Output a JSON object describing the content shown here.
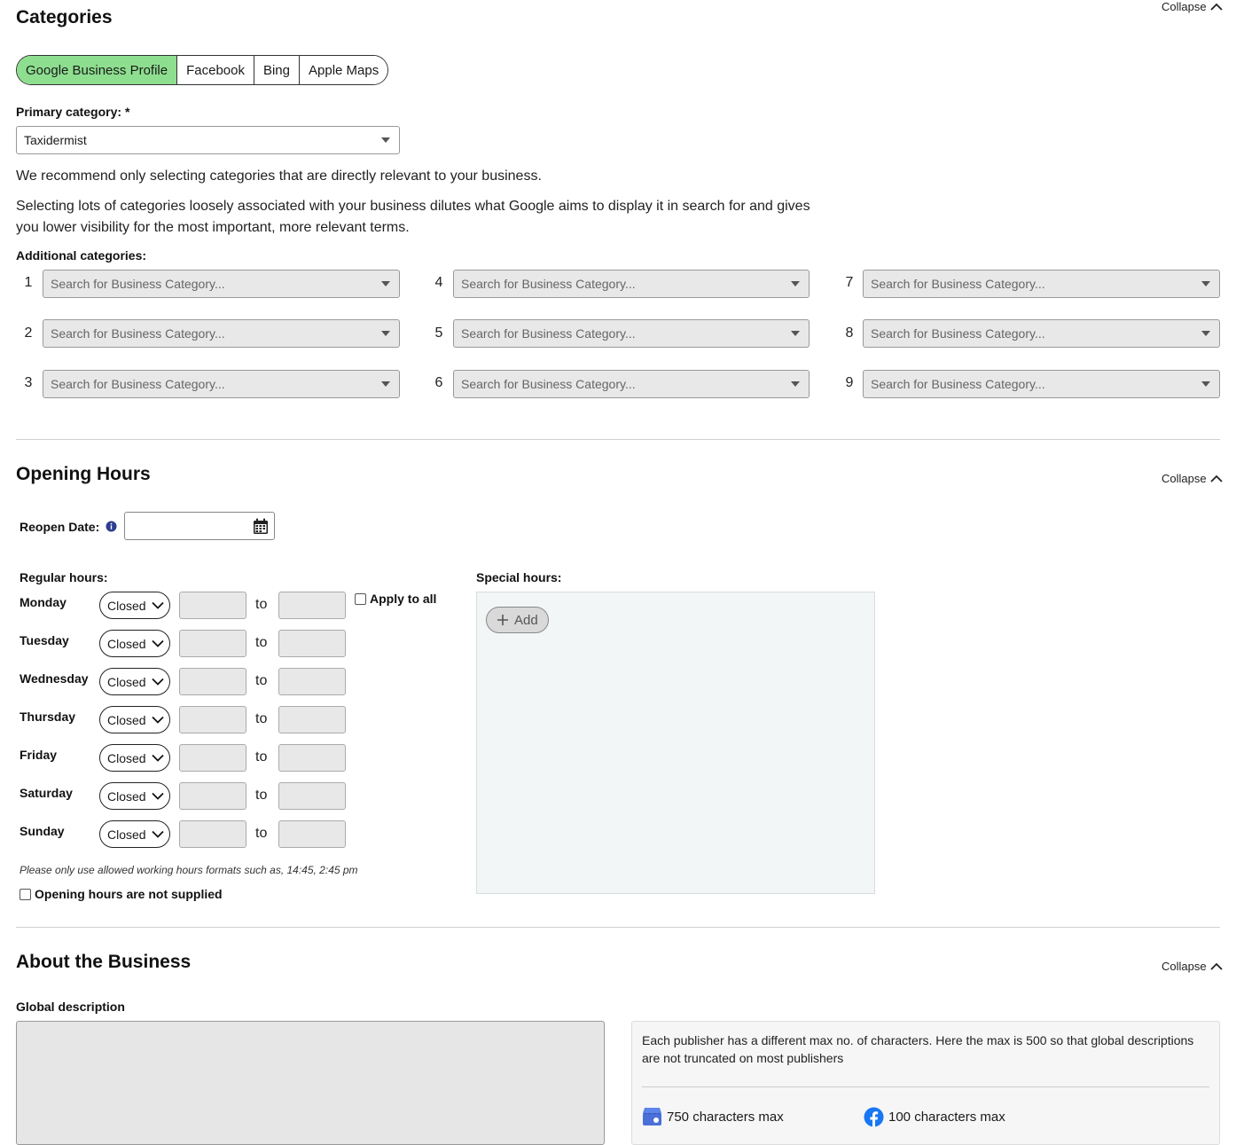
{
  "categories": {
    "title": "Categories",
    "collapse_label": "Collapse",
    "tabs": [
      {
        "label": "Google Business Profile",
        "active": true
      },
      {
        "label": "Facebook",
        "active": false
      },
      {
        "label": "Bing",
        "active": false
      },
      {
        "label": "Apple Maps",
        "active": false
      }
    ],
    "primary_label": "Primary category: *",
    "primary_value": "Taxidermist",
    "recommend_text": "We recommend only selecting categories that are directly relevant to your business.",
    "dilute_text_line1": "Selecting lots of categories loosely associated with your business dilutes what Google aims to display it in search for and gives",
    "dilute_text_line2": "you lower visibility for the most important, more relevant terms.",
    "additional_label": "Additional categories:",
    "additional": [
      {
        "num": "1",
        "placeholder": "Search for Business Category..."
      },
      {
        "num": "2",
        "placeholder": "Search for Business Category..."
      },
      {
        "num": "3",
        "placeholder": "Search for Business Category..."
      },
      {
        "num": "4",
        "placeholder": "Search for Business Category..."
      },
      {
        "num": "5",
        "placeholder": "Search for Business Category..."
      },
      {
        "num": "6",
        "placeholder": "Search for Business Category..."
      },
      {
        "num": "7",
        "placeholder": "Search for Business Category..."
      },
      {
        "num": "8",
        "placeholder": "Search for Business Category..."
      },
      {
        "num": "9",
        "placeholder": "Search for Business Category..."
      }
    ]
  },
  "hours": {
    "title": "Opening Hours",
    "collapse_label": "Collapse",
    "reopen_label": "Reopen Date:",
    "reopen_value": "",
    "regular_label": "Regular hours:",
    "special_label": "Special hours:",
    "apply_all_label": "Apply to all",
    "to_label": "to",
    "days": [
      {
        "day": "Monday",
        "status": "Closed"
      },
      {
        "day": "Tuesday",
        "status": "Closed"
      },
      {
        "day": "Wednesday",
        "status": "Closed"
      },
      {
        "day": "Thursday",
        "status": "Closed"
      },
      {
        "day": "Friday",
        "status": "Closed"
      },
      {
        "day": "Saturday",
        "status": "Closed"
      },
      {
        "day": "Sunday",
        "status": "Closed"
      }
    ],
    "add_label": "Add",
    "hint": "Please only use allowed working hours formats such as, 14:45, 2:45 pm",
    "not_supplied_label": "Opening hours are not supplied"
  },
  "about": {
    "title": "About the Business",
    "collapse_label": "Collapse",
    "global_desc_label": "Global description",
    "info_line1": "Each publisher has a different max no. of characters. Here the max is 500 so that global descriptions",
    "info_line2": "are not truncated on most publishers",
    "limits": [
      {
        "icon": "google-business-icon",
        "text": "750 characters max"
      },
      {
        "icon": "facebook-icon",
        "text": "100 characters max"
      }
    ]
  },
  "colors": {
    "active_tab": "#8ddf8f",
    "info_icon": "#2c3e91",
    "facebook_blue": "#1877f2",
    "google_business_blue": "#4a6fd8"
  }
}
